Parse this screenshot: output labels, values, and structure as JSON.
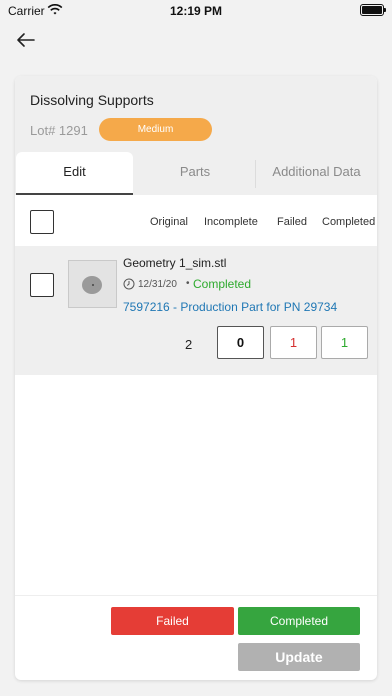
{
  "status_bar": {
    "carrier": "Carrier",
    "time": "12:19 PM"
  },
  "header": {
    "title": "Dissolving Supports",
    "lot": "Lot# 1291",
    "priority": "Medium",
    "priority_color": "#f5a94a"
  },
  "tabs": [
    {
      "label": "Edit",
      "active": true
    },
    {
      "label": "Parts",
      "active": false
    },
    {
      "label": "Additional Data",
      "active": false
    }
  ],
  "columns": [
    "Original",
    "Incomplete",
    "Failed",
    "Completed"
  ],
  "part": {
    "name": "Geometry 1_sim.stl",
    "date": "12/31/20",
    "separator": "•",
    "status": "Completed",
    "link": "7597216 - Production Part for PN 29734",
    "total": "2",
    "counts": {
      "original": "0",
      "failed": "1",
      "completed": "1"
    }
  },
  "actions": {
    "failed": "Failed",
    "completed": "Completed",
    "update": "Update"
  },
  "colors": {
    "failed": "#e53d36",
    "completed": "#36a53f",
    "update_disabled": "#b1b1b1",
    "link": "#1f77b4"
  },
  "icons": [
    "wifi-icon",
    "battery-icon",
    "back-arrow-icon",
    "clock-icon",
    "part-thumbnail"
  ]
}
